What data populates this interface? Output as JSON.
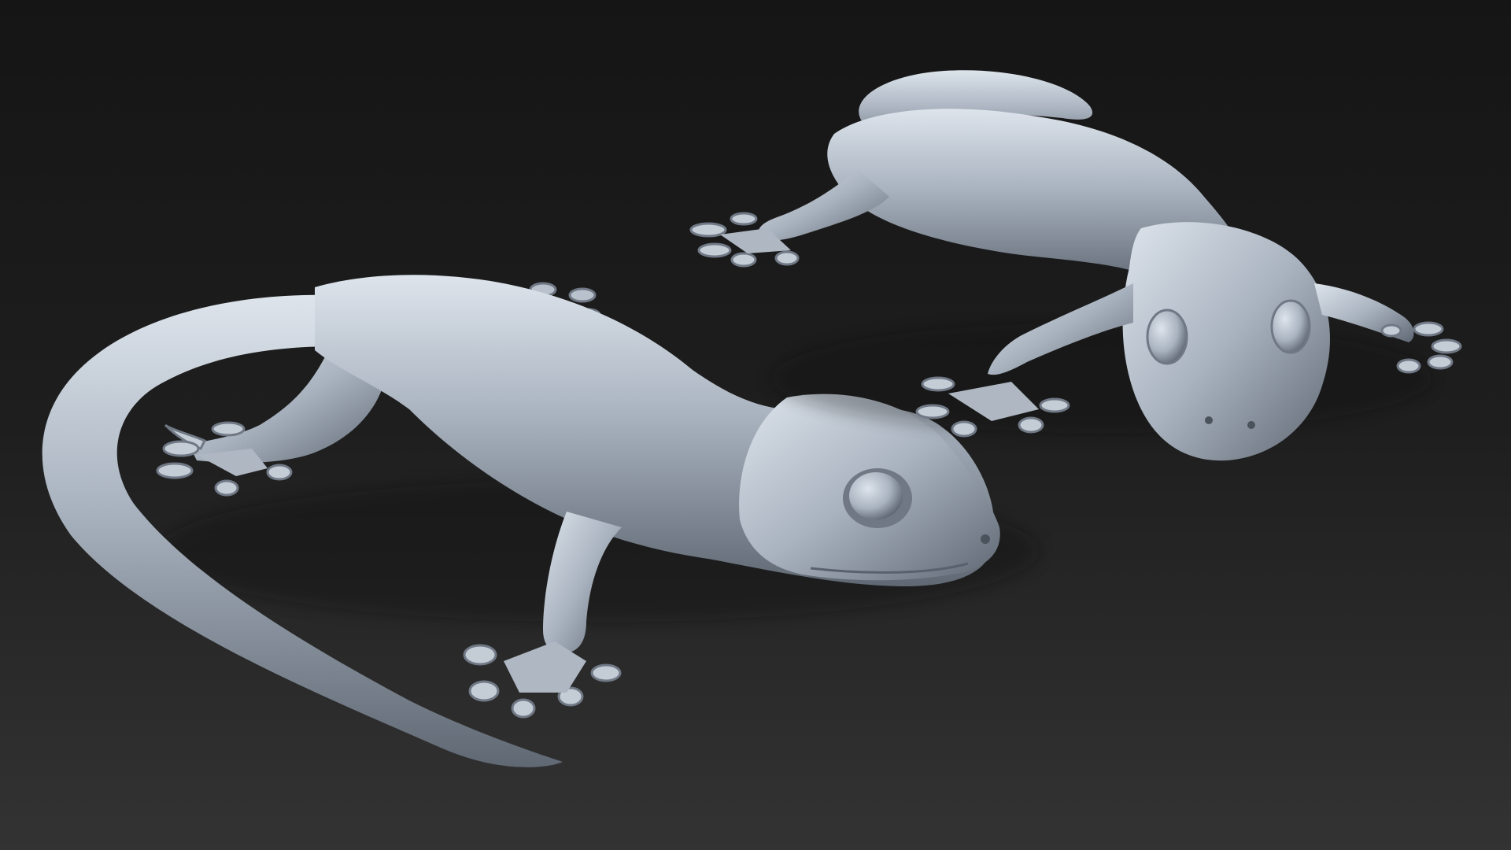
{
  "scene": {
    "background_top": "#151515",
    "background_mid": "#1e1e1e",
    "background_bottom": "#333333",
    "model_light": "#dde4ec",
    "model_mid": "#a9b3bf",
    "model_dark": "#5f6873",
    "model_shadow": "#3d434b"
  }
}
